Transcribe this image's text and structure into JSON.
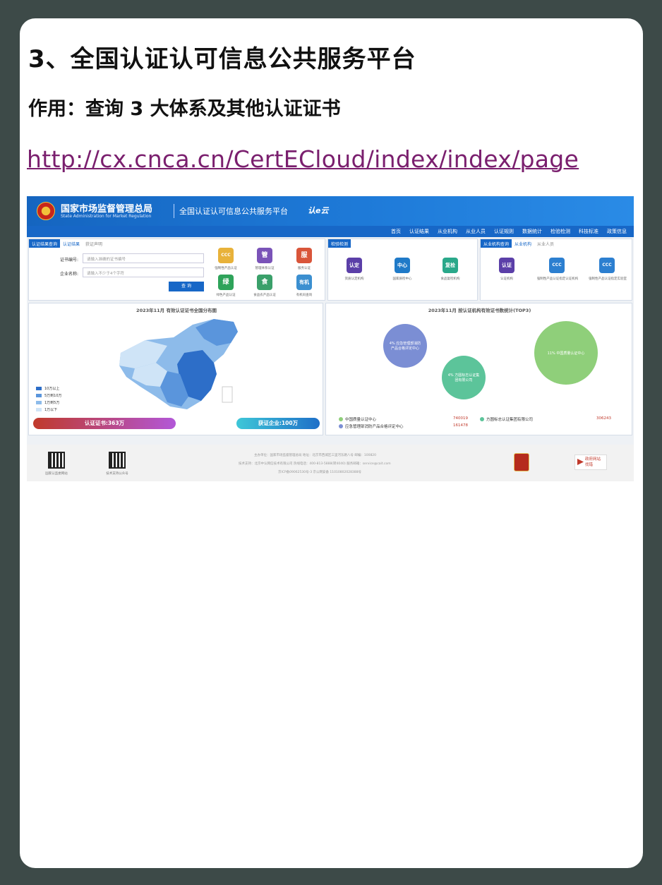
{
  "heading": "3、全国认证认可信息公共服务平台",
  "subheading": "作用：查询 3 大体系及其他认证证书",
  "url": "http://cx.cnca.cn/CertECloud/index/index/page",
  "site": {
    "org_name": "国家市场监督管理总局",
    "org_name_en": "State Administration for Market Regulation",
    "platform": "全国认证认可信息公共服务平台",
    "brand": "认e云",
    "nav": [
      "首页",
      "认证结果",
      "从业机构",
      "从业人员",
      "认证规则",
      "数据统计",
      "检验检测",
      "科技标准",
      "政策信息"
    ],
    "query_panel": {
      "tabs": [
        "认证结果查询",
        "认证结果",
        "获证声明"
      ],
      "cert_no_label": "证书编号:",
      "cert_no_placeholder": "请输入准确的证书编号",
      "company_label": "企业名称:",
      "company_placeholder": "请输入不少于4个字符",
      "search_button": "查 询",
      "icons": [
        {
          "glyph": "CCC",
          "caption": "强制性产品认证",
          "color": "#e8b23a"
        },
        {
          "glyph": "管",
          "caption": "管理体系认证",
          "color": "#7a53b8"
        },
        {
          "glyph": "服",
          "caption": "服务认证",
          "color": "#d9553a"
        },
        {
          "glyph": "绿",
          "caption": "绿色产品认证",
          "color": "#2ea35a"
        },
        {
          "glyph": "食",
          "caption": "食品农产品认证",
          "color": "#3aa06a"
        },
        {
          "glyph": "有机",
          "caption": "有机码查询",
          "color": "#3b8fd0"
        }
      ]
    },
    "inspection_panel": {
      "tabs": [
        "检验检测"
      ],
      "icons": [
        {
          "glyph": "认定",
          "caption": "资质认定机构",
          "color": "#5b3fa8"
        },
        {
          "glyph": "中心",
          "caption": "国家质检中心",
          "color": "#1f7ac8"
        },
        {
          "glyph": "复检",
          "caption": "食品复检机构",
          "color": "#2aa88a"
        }
      ]
    },
    "agency_panel": {
      "tabs": [
        "从业机构查询",
        "从业机构",
        "从业人员"
      ],
      "icons": [
        {
          "glyph": "认证",
          "caption": "认证机构",
          "color": "#5b3fa8"
        },
        {
          "glyph": "CCC",
          "caption": "强制性产品认证指定认证机构",
          "color": "#2c7fd0"
        },
        {
          "glyph": "CCC",
          "caption": "强制性产品认证指定实验室",
          "color": "#2c7fd0"
        }
      ]
    },
    "map_panel": {
      "title": "2023年11月 有效认证证书全国分布图",
      "legend": [
        {
          "label": "10万以上",
          "color": "#2d6ec8"
        },
        {
          "label": "5万到10万",
          "color": "#5a95dc"
        },
        {
          "label": "1万到5万",
          "color": "#8dbbea"
        },
        {
          "label": "1万以下",
          "color": "#cfe4f7"
        }
      ],
      "cert_total": "认证证书:363万",
      "company_total": "获证企业:100万"
    },
    "footer": {
      "qr1_caption": "国家认监委网站",
      "qr2_caption": "技术支持公众号",
      "line1": "主办单位：国家市场监督管理总局    地址：北京市西城区三里河东路八号    邮编：100820",
      "line2": "技术支持：北京中认网信技术有限公司    热线电话：400-813-5888(转4040)    服务邮箱：service@cait.com",
      "line3": "京ICP备09062530号-3    京公网安备 11010802028388号",
      "gov_label1": "政府网站",
      "gov_label2": "找错"
    }
  },
  "chart_data": [
    {
      "type": "bubble",
      "title": "2023年11月  按认证机构有效证书数统计(TOP3)",
      "series": [
        {
          "name": "中国质量认证中心",
          "value": 740019,
          "share": "11%",
          "color": "#8fcf7a"
        },
        {
          "name": "方圆标志认证集团有限公司",
          "value": 306243,
          "share": "4%",
          "color": "#5cc49a"
        },
        {
          "name": "应急管理部消防产品合格评定中心",
          "value": 161478,
          "share": "4%",
          "color": "#7b8ed4"
        }
      ],
      "bubble_labels": [
        {
          "share": "4%",
          "text": "应急管理部消防产品合格评定中心"
        },
        {
          "share": "4%",
          "text": "方圆标志认证集团有限公司"
        },
        {
          "share": "11%",
          "text": "中国质量认证中心"
        }
      ]
    }
  ]
}
